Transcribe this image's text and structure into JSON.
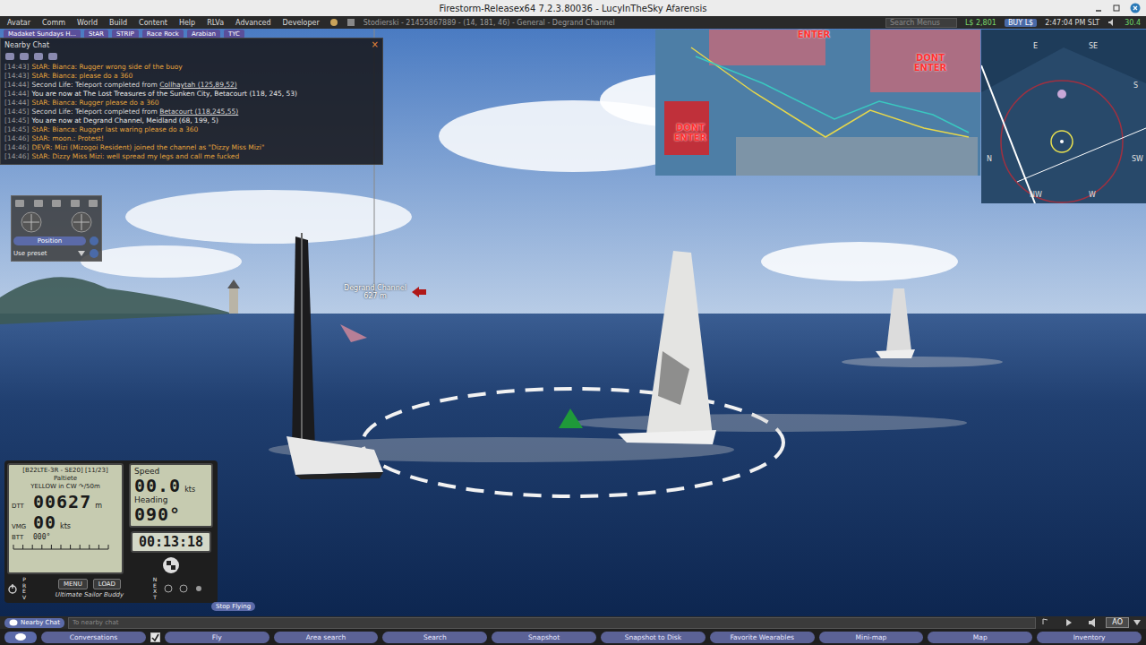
{
  "window": {
    "title": "Firestorm-Releasex64 7.2.3.80036 - LucyInTheSky Afarensis"
  },
  "menu": [
    "Avatar",
    "Comm",
    "World",
    "Build",
    "Content",
    "Help",
    "RLVa",
    "Advanced",
    "Developer"
  ],
  "location": "Stodierski - 21455867889 - (14, 181, 46) - General - Degrand Channel",
  "search": {
    "placeholder": "Search Menus"
  },
  "status": {
    "balance": "L$ 2,801",
    "buy": "BUY L$",
    "time": "2:47:04 PM SLT",
    "fps": "30.4"
  },
  "favorites": [
    "Madaket Sundays H...",
    "StAR",
    "STRIP",
    "Race Rock",
    "Arabian",
    "TYC"
  ],
  "nearby_chat": {
    "title": "Nearby Chat",
    "close": "×",
    "lines": [
      {
        "time": "[14:43]",
        "text": "StAR: Bianca: Rugger wrong side of the buoy",
        "link": "",
        "color": "#e3a33c"
      },
      {
        "time": "[14:43]",
        "text": "StAR: Bianca: please do a 360",
        "link": "",
        "color": "#e3a33c"
      },
      {
        "time": "[14:44]",
        "text": "Second Life: Teleport completed from ",
        "link": "Collhaytah (125,89,52)",
        "color": "#d8d8d8"
      },
      {
        "time": "[14:44]",
        "text": "You are now at The Lost Treasures of the Sunken City, Betacourt (118, 245, 53)",
        "link": "",
        "color": "#e8e8e8"
      },
      {
        "time": "[14:44]",
        "text": "StAR: Bianca: Rugger please do a 360",
        "link": "",
        "color": "#e3a33c"
      },
      {
        "time": "[14:45]",
        "text": "Second Life: Teleport completed from ",
        "link": "Betacourt (118,245,55)",
        "color": "#d8d8d8"
      },
      {
        "time": "[14:45]",
        "text": "You are now at Degrand Channel, Meidland (68, 199, 5)",
        "link": "",
        "color": "#e8e8e8"
      },
      {
        "time": "[14:45]",
        "text": "StAR: Bianca: Rugger last waring please do a 360",
        "link": "",
        "color": "#e3a33c"
      },
      {
        "time": "[14:46]",
        "text": "StAR: moon.: Protest!",
        "link": "",
        "color": "#e3a33c"
      },
      {
        "time": "[14:46]",
        "text": "DEVR: Mizi (Mizogoi Resident) joined the channel as \"Dizzy Miss Mizi\"",
        "link": "",
        "color": "#e3a33c"
      },
      {
        "time": "[14:46]",
        "text": "StAR: Dizzy Miss Mizi: well spread my legs and call me fucked",
        "link": "",
        "color": "#e3a33c"
      }
    ]
  },
  "camera_controls": {
    "position": "Position",
    "preset": "Use preset"
  },
  "scene": {
    "marker": {
      "label": "Degrand Channel",
      "distance": "627 m"
    }
  },
  "map_overlay": {
    "labels": [
      "ENTER",
      "DONT ENTER",
      "DONT ENTER"
    ]
  },
  "minimap": {
    "compass": [
      "E",
      "SE",
      "S",
      "SW",
      "W",
      "NW",
      "N"
    ]
  },
  "hud": {
    "race": "[B22LTE-3R - SE20] [11/23]",
    "course": "Paltiete",
    "mark": "YELLOW in CW ↷/50m",
    "dtt": {
      "label": "DTT",
      "value": "00627",
      "unit": "m"
    },
    "vmg": {
      "label": "VMG",
      "value": "00",
      "unit": "kts"
    },
    "btt": {
      "label": "BTT",
      "value": "000°"
    },
    "speed": {
      "label": "Speed",
      "value": "00.0",
      "unit": "kts"
    },
    "heading": {
      "label": "Heading",
      "value": "090°"
    },
    "timer": "00:13:18",
    "buttons": {
      "prev": "PREV",
      "menu": "MENU",
      "load": "LOAD",
      "next": "NEXT"
    },
    "brand": "Ultimate Sailor Buddy",
    "stop_flying": "Stop Flying"
  },
  "chat_bar": {
    "button": "Nearby Chat",
    "placeholder": "To nearby chat",
    "ao": "AO"
  },
  "toolbar": {
    "check": {
      "checked": true
    },
    "buttons": [
      "Conversations",
      "Fly",
      "Area search",
      "Search",
      "Snapshot",
      "Snapshot to Disk",
      "Favorite Wearables",
      "Mini-map",
      "Map",
      "Inventory"
    ]
  }
}
